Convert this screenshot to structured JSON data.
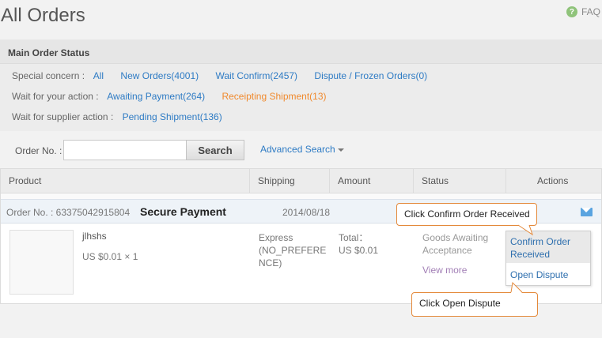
{
  "header": {
    "title": "All Orders",
    "faq_label": "FAQ"
  },
  "main_status": {
    "heading": "Main Order Status",
    "rows": [
      {
        "label": "Special concern :",
        "links": [
          "All",
          "New Orders(4001)",
          "Wait Confirm(2457)",
          "Dispute / Frozen Orders(0)"
        ]
      },
      {
        "label": "Wait for your action :",
        "links": [
          "Awaiting Payment(264)",
          "Receipting Shipment(13)"
        ]
      },
      {
        "label": "Wait for supplier action :",
        "links": [
          "Pending Shipment(136)"
        ]
      }
    ],
    "active_color": "#f08a2e",
    "link_color": "#2e7bc4"
  },
  "search": {
    "label": "Order No. :",
    "input_value": "",
    "button_label": "Search",
    "advanced_label": "Advanced Search"
  },
  "table": {
    "columns": [
      "Product",
      "Shipping",
      "Amount",
      "Status",
      "Actions"
    ],
    "order": {
      "number_text": "Order No. : 63375042915804",
      "payment_label": "Secure Payment",
      "date": "2014/08/18",
      "product_name": "jlhshs",
      "product_price": "US $0.01 × 1",
      "shipping_line1": "Express",
      "shipping_line2": "(NO_PREFERE",
      "shipping_line3": "NCE)",
      "amount_line1": "Total：",
      "amount_line2": "US $0.01",
      "status_line1": "Goods Awaiting",
      "status_line2": "Acceptance",
      "view_more": "View more",
      "action_confirm_line1": "Confirm Order",
      "action_confirm_line2": "Received",
      "action_dispute": "Open Dispute"
    }
  },
  "callouts": {
    "confirm": "Click Confirm Order Received",
    "dispute": "Click Open Dispute"
  }
}
